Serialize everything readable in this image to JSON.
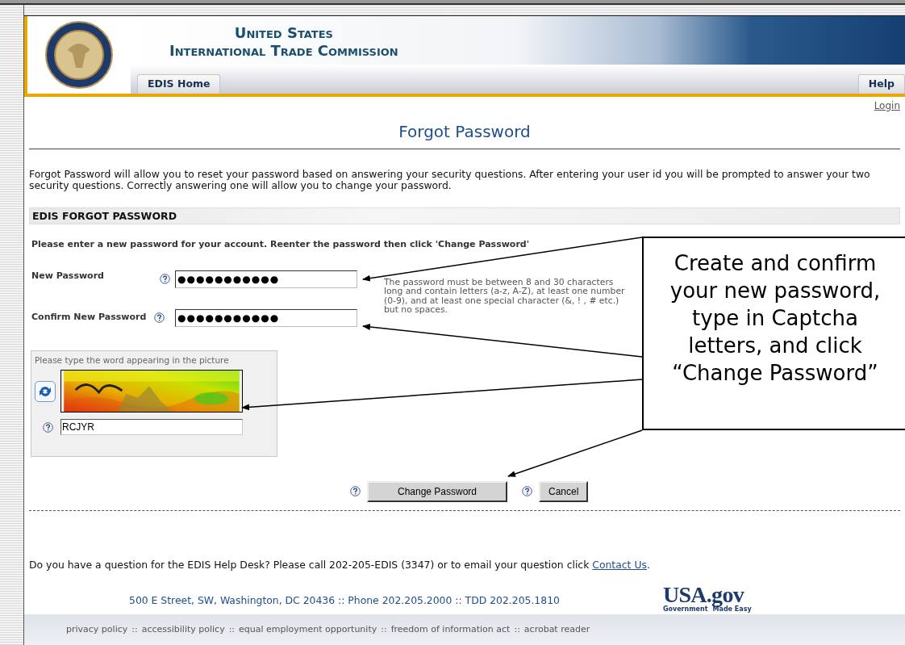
{
  "header": {
    "title_line_1": "United States",
    "title_line_2": "International Trade Commission",
    "tabs": [
      {
        "label": "EDIS Home",
        "selected": false
      },
      {
        "label": "Help",
        "selected": false
      }
    ]
  },
  "login_link": "Login",
  "page_title": "Forgot Password",
  "intro": "Forgot Password will allow you to reset your password based on answering your security questions.  After entering your user id you will be prompted to answer your two security questions. Correctly answering one will allow you to change your password.",
  "section_header": "EDIS FORGOT PASSWORD",
  "instruction": "Please enter a new password for your account. Reenter the password then click 'Change Password'",
  "fields": [
    {
      "label": "New Password",
      "value": "●●●●●●●●●●●"
    },
    {
      "label": "Confirm New Password",
      "value": "●●●●●●●●●●●"
    }
  ],
  "password_hint": "The password must be between 8 and 30 characters long and contain letters (a-z, A-Z), at least one number (0-9), and at least one special character (&, ! , # etc.) but no spaces.",
  "captcha": {
    "prompt": "Please type the word appearing in the picture",
    "value": "RCJYR"
  },
  "buttons": [
    {
      "label": "Change Password"
    },
    {
      "label": "Cancel"
    }
  ],
  "help_desk": {
    "text": "Do you have a question for the EDIS Help Desk?   Please call 202-205-EDIS (3347) or to email your question click ",
    "link": "Contact Us",
    "end": "."
  },
  "address": "500 E Street, SW, Washington, DC 20436 :: Phone 202.205.2000 :: TDD 202.205.1810",
  "usa_gov": {
    "logo": "USA.gov",
    "tagline_1": "Government",
    "tagline_2": "Made Easy"
  },
  "footer": {
    "separator": "::",
    "links": [
      "privacy policy",
      "accessibility policy",
      "equal employment opportunity",
      "freedom of information act",
      "acrobat reader"
    ]
  },
  "callout": "Create and confirm your new password, type in Captcha letters, and click “Change Password”"
}
